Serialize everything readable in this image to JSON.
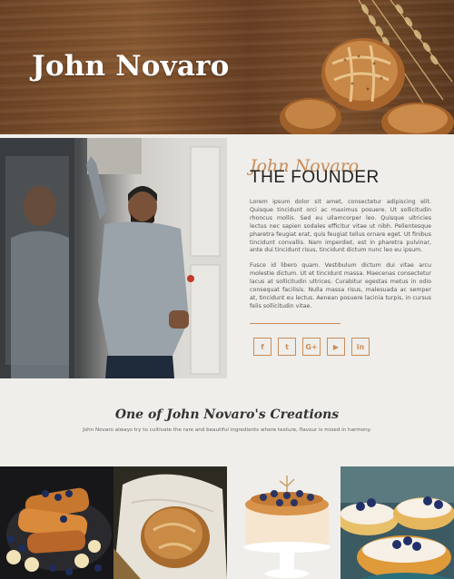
{
  "hero": {
    "title": "John Novaro"
  },
  "founder": {
    "script_name": "John Novaro",
    "heading": "THE FOUNDER",
    "paragraph_1": "Lorem ipsum dolor sit amet, consectetur adipiscing elit. Quisque tincidunt orci ac maximus posuere. Ut sollicitudin rhoncus mollis. Sed eu ullamcorper leo. Quisque ultricies lectus nec sapien sodales efficitur vitae ut nibh. Pellentesque pharetra feugiat erat, quis feugiat tellus ornare eget. Ut finibus tincidunt convallis. Nam imperdiet, est in pharetra pulvinar, ante dui tincidunt risus, tincidunt dictum nunc leo eu ipsum.",
    "paragraph_2": "Fusce id libero quam. Vestibulum dictum dui vitae arcu molestie dictum. Ut et tincidunt massa. Maecenas consectetur lacus at sollicitudin ultrices. Curabitur egestas metus in odio consequat facilisis. Nulla massa risus, malesuada ac semper at, tincidunt eu lectus. Aenean posuere lacinia turpis, in cursus felis sollicitudin vitae.",
    "socials": [
      {
        "name": "facebook",
        "glyph": "f"
      },
      {
        "name": "twitter",
        "glyph": "t"
      },
      {
        "name": "google-plus",
        "glyph": "G+"
      },
      {
        "name": "youtube",
        "glyph": "▶"
      },
      {
        "name": "linkedin",
        "glyph": "in"
      }
    ]
  },
  "creations": {
    "title": "One of John Novaro's Creations",
    "subtitle": "John Novaro always try to cultivate the rare and beautiful ingredients where texture, flavour is mixed in harmony."
  },
  "colors": {
    "accent": "#c88d5b",
    "background": "#efeeea",
    "heading": "#222222"
  }
}
